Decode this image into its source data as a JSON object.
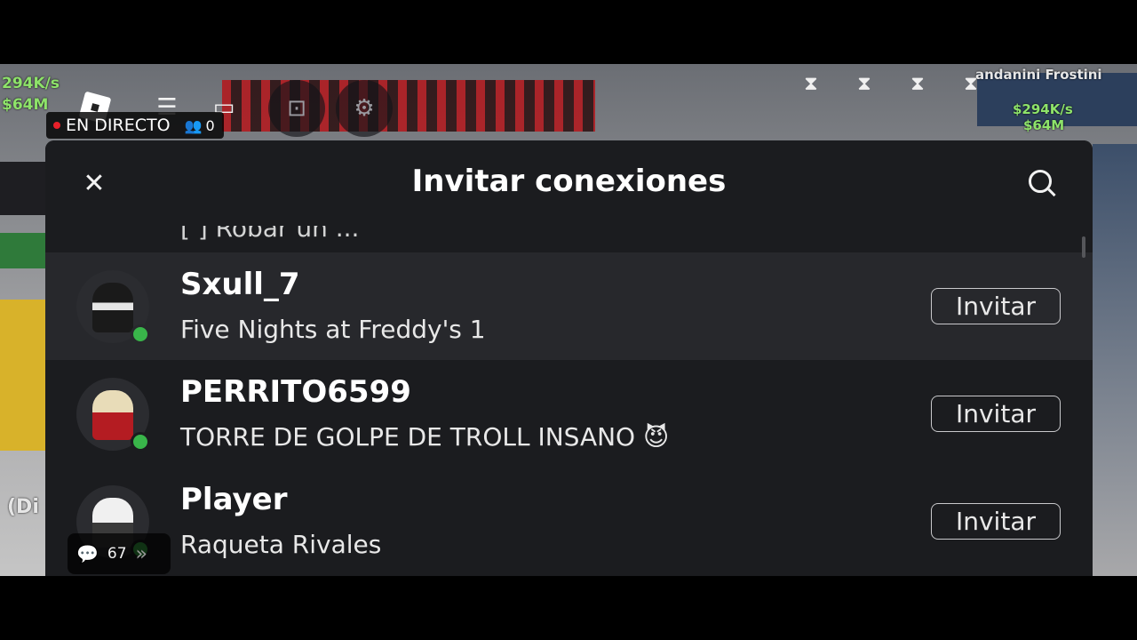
{
  "game_hud": {
    "money_top": "294K/s",
    "money_sub": "$64M",
    "brainrot_name": "andanini Frostini",
    "rate": "$294K/s",
    "value": "$64M",
    "side_text": "(Di"
  },
  "controls": {
    "menu_icon": "hamburger-icon",
    "chat_icon": "chat-icon",
    "backpack_icon": "backpack-icon",
    "settings_icon": "gear-icon"
  },
  "live": {
    "label": "EN DIRECTO",
    "viewers": "0"
  },
  "modal": {
    "title": "Invitar conexiones",
    "partial_row_text": "[  ] Robar un ...",
    "connections": [
      {
        "username": "Sxull_7",
        "activity": "Five Nights at Freddy's 1",
        "invite_label": "Invitar",
        "online": true
      },
      {
        "username": "PERRITO6599",
        "activity": "TORRE DE GOLPE DE TROLL INSANO 😈",
        "invite_label": "Invitar",
        "online": true
      },
      {
        "username": "Player",
        "activity": "Raqueta Rivales",
        "invite_label": "Invitar",
        "online": true
      }
    ]
  },
  "chat_overlay": {
    "count": "67"
  },
  "colors": {
    "modal_bg": "#1b1c1f",
    "selected_row_bg": "#27282c",
    "online_green": "#39b54a",
    "live_red": "#e8202a"
  }
}
